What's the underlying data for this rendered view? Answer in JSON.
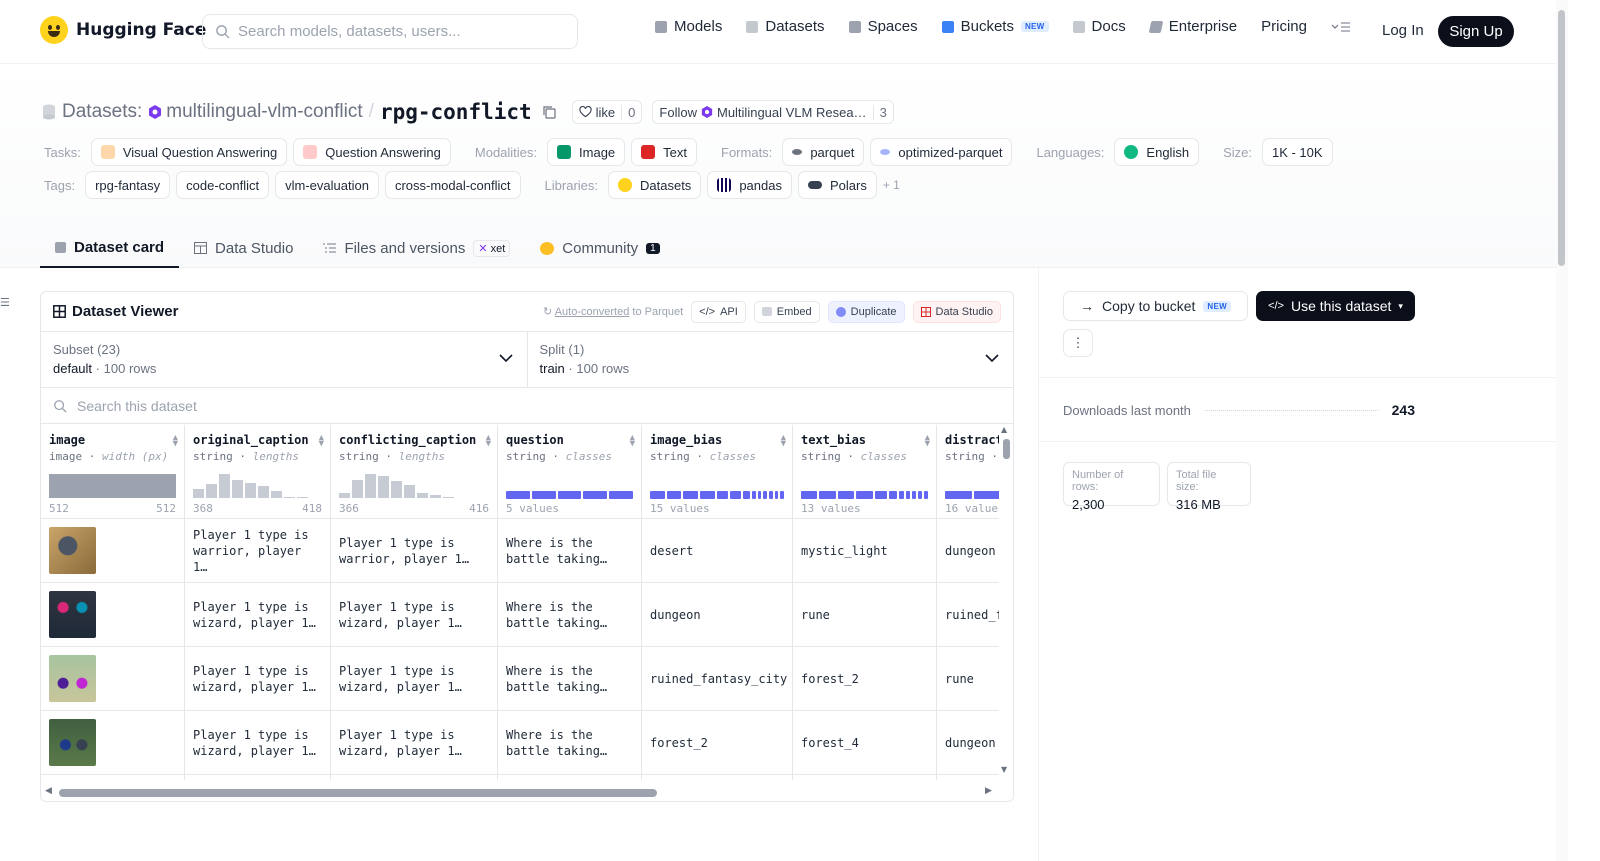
{
  "nav": {
    "brand": "Hugging Face",
    "search_placeholder": "Search models, datasets, users...",
    "links": [
      {
        "label": "Models",
        "color": "#6b7280"
      },
      {
        "label": "Datasets",
        "color": "#9ca3af"
      },
      {
        "label": "Spaces",
        "color": "#6b7280"
      },
      {
        "label": "Buckets",
        "color": "#3b82f6"
      },
      {
        "label": "Docs",
        "color": "#9ca3af"
      },
      {
        "label": "Enterprise",
        "color": "#6b7280"
      },
      {
        "label": "Pricing",
        "color": ""
      }
    ],
    "buckets_badge": "NEW",
    "login": "Log In",
    "signup": "Sign Up"
  },
  "repo": {
    "kind": "Datasets:",
    "owner": "multilingual-vlm-conflict",
    "name": "rpg-conflict",
    "like_label": "like",
    "like_count": "0",
    "follow_label": "Follow",
    "follow_org": "Multilingual VLM Resea…",
    "follow_count": "3"
  },
  "meta": {
    "tasks_label": "Tasks:",
    "tasks": [
      "Visual Question Answering",
      "Question Answering"
    ],
    "modalities_label": "Modalities:",
    "modalities": [
      "Image",
      "Text"
    ],
    "formats_label": "Formats:",
    "formats": [
      "parquet",
      "optimized-parquet"
    ],
    "languages_label": "Languages:",
    "languages": [
      "English"
    ],
    "size_label": "Size:",
    "size": "1K - 10K",
    "tags_label": "Tags:",
    "tags": [
      "rpg-fantasy",
      "code-conflict",
      "vlm-evaluation",
      "cross-modal-conflict"
    ],
    "libraries_label": "Libraries:",
    "libraries": [
      "Datasets",
      "pandas",
      "Polars"
    ],
    "libraries_more": "+ 1"
  },
  "tabs": [
    {
      "label": "Dataset card",
      "active": true
    },
    {
      "label": "Data Studio"
    },
    {
      "label": "Files and versions",
      "badge": "xet"
    },
    {
      "label": "Community",
      "badge": "1"
    }
  ],
  "viewer": {
    "title": "Dataset Viewer",
    "auto_link": "Auto-converted",
    "auto_rest": " to Parquet",
    "api": "API",
    "embed": "Embed",
    "duplicate": "Duplicate",
    "data_studio": "Data Studio",
    "subset_label": "Subset (23)",
    "subset_value": "default",
    "subset_rows": "100 rows",
    "split_label": "Split (1)",
    "split_value": "train",
    "split_rows": "100 rows",
    "search_placeholder": "Search this dataset",
    "columns": [
      {
        "name": "image",
        "type": "image",
        "stat": "width (px)",
        "min": "512",
        "max": "512"
      },
      {
        "name": "original_caption",
        "type": "string",
        "stat": "lengths",
        "min": "368",
        "max": "418"
      },
      {
        "name": "conflicting_caption",
        "type": "string",
        "stat": "lengths",
        "min": "366",
        "max": "416"
      },
      {
        "name": "question",
        "type": "string",
        "stat": "classes",
        "min": "5 values",
        "max": ""
      },
      {
        "name": "image_bias",
        "type": "string",
        "stat": "classes",
        "min": "15 values",
        "max": ""
      },
      {
        "name": "text_bias",
        "type": "string",
        "stat": "classes",
        "min": "13 values",
        "max": ""
      },
      {
        "name": "distract",
        "type": "string",
        "stat": "",
        "min": "16 value",
        "max": ""
      }
    ],
    "rows": [
      {
        "orig": "Player 1 type is\nwarrior, player 1…",
        "conf": "Player 1 type is\nwarrior, player 1…",
        "q": "Where is the\nbattle taking…",
        "ib": "desert",
        "tb": "mystic_light",
        "d": "dungeon"
      },
      {
        "orig": "Player 1 type is\nwizard, player 1…",
        "conf": "Player 1 type is\nwizard, player 1…",
        "q": "Where is the\nbattle taking…",
        "ib": "dungeon",
        "tb": "rune",
        "d": "ruined_f"
      },
      {
        "orig": "Player 1 type is\nwizard, player 1…",
        "conf": "Player 1 type is\nwizard, player 1…",
        "q": "Where is the\nbattle taking…",
        "ib": "ruined_fantasy_city",
        "tb": "forest_2",
        "d": "rune"
      },
      {
        "orig": "Player 1 type is\nwizard, player 1…",
        "conf": "Player 1 type is\nwizard, player 1…",
        "q": "Where is the\nbattle taking…",
        "ib": "forest_2",
        "tb": "forest_4",
        "d": "dungeon"
      }
    ]
  },
  "sidebar": {
    "copy_label": "Copy to bucket",
    "copy_badge": "NEW",
    "use_label": "Use this dataset",
    "downloads_label": "Downloads last month",
    "downloads_value": "243",
    "rows_label": "Number of rows:",
    "rows_value": "2,300",
    "size_label": "Total file size:",
    "size_value": "316 MB"
  }
}
